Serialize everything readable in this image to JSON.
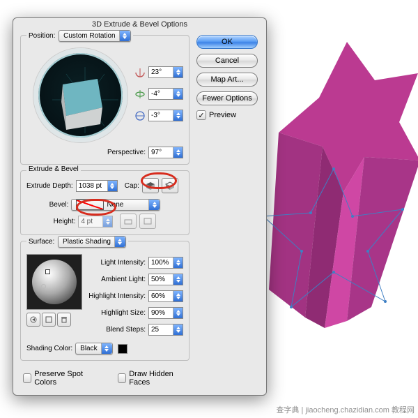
{
  "dialog": {
    "title": "3D Extrude & Bevel Options",
    "position": {
      "label": "Position:",
      "value": "Custom Rotation"
    },
    "angles": {
      "x": "23°",
      "y": "-4°",
      "z": "-3°"
    },
    "perspective": {
      "label": "Perspective:",
      "value": "97°"
    },
    "extrudeSection": {
      "title": "Extrude & Bevel",
      "depthLabel": "Extrude Depth:",
      "depthValue": "1038 pt",
      "capLabel": "Cap:",
      "bevelLabel": "Bevel:",
      "bevelValue": "None",
      "heightLabel": "Height:",
      "heightValue": "4 pt"
    },
    "surfaceSection": {
      "title": "Surface:",
      "value": "Plastic Shading",
      "lightIntensityLabel": "Light Intensity:",
      "lightIntensityValue": "100%",
      "ambientLabel": "Ambient Light:",
      "ambientValue": "50%",
      "hiIntensityLabel": "Highlight Intensity:",
      "hiIntensityValue": "60%",
      "hiSizeLabel": "Highlight Size:",
      "hiSizeValue": "90%",
      "blendLabel": "Blend Steps:",
      "blendValue": "25",
      "shadingColorLabel": "Shading Color:",
      "shadingColorValue": "Black"
    },
    "footer": {
      "preserveSpot": "Preserve Spot Colors",
      "drawHidden": "Draw Hidden Faces"
    },
    "buttons": {
      "ok": "OK",
      "cancel": "Cancel",
      "map": "Map Art...",
      "fewer": "Fewer Options",
      "preview": "Preview"
    }
  },
  "watermark": "查字典 | jiaocheng.chazidian.com 教程网"
}
